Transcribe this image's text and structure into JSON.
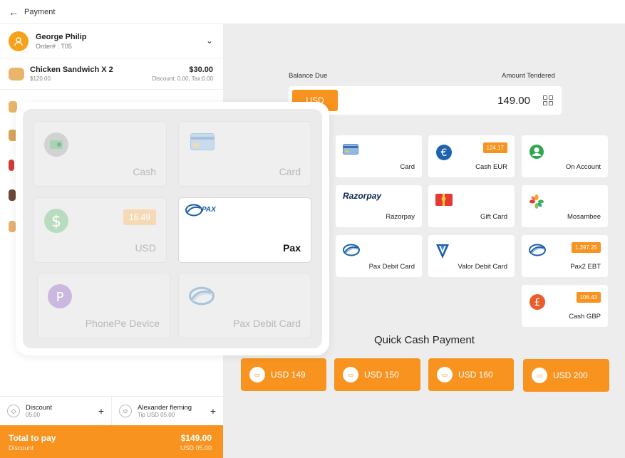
{
  "header": {
    "title": "Payment"
  },
  "customer": {
    "name": "George Philip",
    "order": "Order# : T05"
  },
  "items": [
    {
      "name": "Chicken Sandwich X 2",
      "sub": "$120.00",
      "price": "$30.00",
      "meta": "Discount: 0.00, Tax:0.00"
    }
  ],
  "discount": {
    "title": "Discount",
    "value": "05.00"
  },
  "staff": {
    "name": "Alexander fleming",
    "tip": "Tip USD 05.00"
  },
  "total": {
    "label": "Total to pay",
    "sub": "Discount",
    "amount": "$149.00",
    "amount_sub": "USD 05.00"
  },
  "balance": {
    "due_label": "Balance Due",
    "tendered_label": "Amount Tendered",
    "currency": "USD",
    "amount": "149.00"
  },
  "tiles": [
    {
      "label": "Card",
      "badge": ""
    },
    {
      "label": "Cash EUR",
      "badge": "124.17"
    },
    {
      "label": "On Account",
      "badge": ""
    },
    {
      "label": "Razorpay",
      "badge": "",
      "logo_text": "Razorpay"
    },
    {
      "label": "Gift Card",
      "badge": ""
    },
    {
      "label": "Mosambee",
      "badge": ""
    },
    {
      "label": "Pax Debit Card",
      "badge": ""
    },
    {
      "label": "Valor Debit Card",
      "badge": ""
    },
    {
      "label": "Pax2 EBT",
      "badge": "1,397.25"
    },
    {
      "label": "Cash GBP",
      "badge": "106.43"
    }
  ],
  "quick_cash": {
    "title": "Quick Cash Payment",
    "buttons": [
      "USD 149",
      "USD 150",
      "USD 160",
      "USD 200"
    ]
  },
  "popup": {
    "tiles": [
      {
        "label": "Cash",
        "badge": ""
      },
      {
        "label": "Card",
        "badge": ""
      },
      {
        "label": "USD",
        "badge": "16.49"
      },
      {
        "label": "Pax",
        "badge": "",
        "logo_text": "PAX"
      },
      {
        "label": "PhonePe Device",
        "badge": ""
      },
      {
        "label": "Pax Debit Card",
        "badge": ""
      }
    ]
  },
  "colors": {
    "accent": "#f7931e",
    "background": "#ededed"
  }
}
